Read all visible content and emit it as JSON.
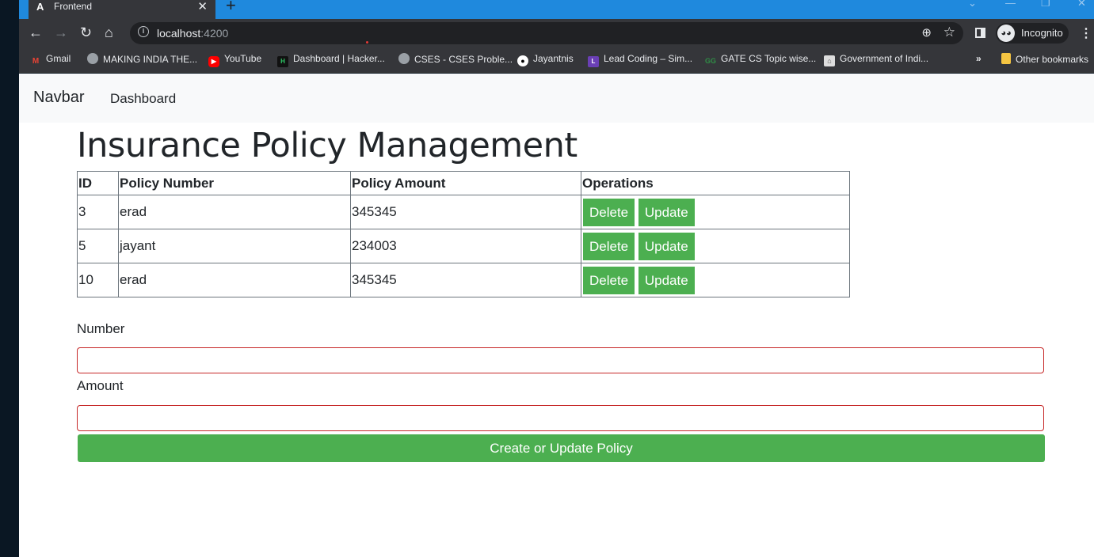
{
  "browser": {
    "tab_title": "Frontend",
    "tab_favicon": "A",
    "url_host": "localhost",
    "url_port": ":4200",
    "profile_label": "Incognito"
  },
  "bookmarks": [
    {
      "label": "Gmail",
      "icon": "gmail-icon",
      "color": "#ea4335"
    },
    {
      "label": "MAKING INDIA THE...",
      "icon": "globe-icon",
      "color": "#9aa0a6"
    },
    {
      "label": "YouTube",
      "icon": "youtube-icon",
      "color": "#ff0000"
    },
    {
      "label": "Dashboard | Hacker...",
      "icon": "hackerrank-icon",
      "color": "#111111"
    },
    {
      "label": "CSES - CSES Proble...",
      "icon": "globe-icon",
      "color": "#9aa0a6"
    },
    {
      "label": "Jayantnis",
      "icon": "github-icon",
      "color": "#ffffff"
    },
    {
      "label": "Lead Coding – Sim...",
      "icon": "leadcoding-icon",
      "color": "#6a3fb5"
    },
    {
      "label": "GATE CS Topic wise...",
      "icon": "geeksforgeeks-icon",
      "color": "#2f8d46"
    },
    {
      "label": "Government of Indi...",
      "icon": "emblem-icon",
      "color": "#dddddd"
    }
  ],
  "bookmarks_more": "»",
  "other_bookmarks": "Other bookmarks",
  "navbar": {
    "brand": "Navbar",
    "link": "Dashboard"
  },
  "page_title": "Insurance Policy Management",
  "table": {
    "headers": [
      "ID",
      "Policy Number",
      "Policy Amount",
      "Operations"
    ],
    "rows": [
      {
        "id": "3",
        "number": "erad",
        "amount": "345345"
      },
      {
        "id": "5",
        "number": "jayant",
        "amount": "234003"
      },
      {
        "id": "10",
        "number": "erad",
        "amount": "345345"
      }
    ],
    "delete_label": "Delete",
    "update_label": "Update"
  },
  "form": {
    "number_label": "Number",
    "number_value": "",
    "amount_label": "Amount",
    "amount_value": "",
    "submit_label": "Create or Update Policy"
  },
  "colors": {
    "accent_green": "#4caf50",
    "invalid_border": "#c62828",
    "tabstrip_blue": "#1f89dd"
  }
}
